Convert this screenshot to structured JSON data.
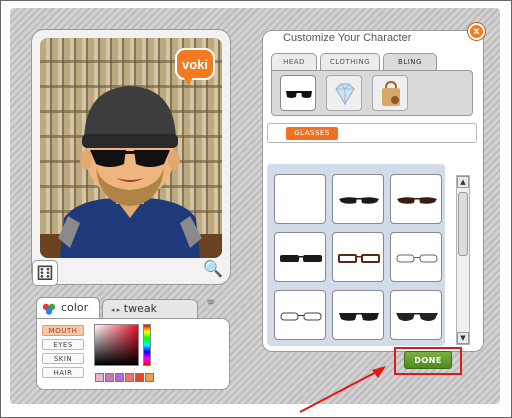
{
  "panel": {
    "title": "Customize Your Character",
    "close_label": "x"
  },
  "logo": {
    "text": "voki"
  },
  "category_tabs": [
    {
      "label": "HEAD",
      "active": false
    },
    {
      "label": "CLOTHING",
      "active": false
    },
    {
      "label": "BLING",
      "active": true
    }
  ],
  "item_types": [
    {
      "icon": "sunglasses-icon",
      "active": true
    },
    {
      "icon": "diamond-icon",
      "active": false
    },
    {
      "icon": "bag-icon",
      "active": false
    }
  ],
  "subcategory": {
    "label": "GLASSES"
  },
  "glasses_grid": [
    {
      "style": "none"
    },
    {
      "style": "dark-cat-eye"
    },
    {
      "style": "dark-cat-eye-brown"
    },
    {
      "style": "dark-wide"
    },
    {
      "style": "brown-rect-frame"
    },
    {
      "style": "thin-white-frame"
    },
    {
      "style": "thin-outline"
    },
    {
      "style": "dark-shield"
    },
    {
      "style": "dark-aviator"
    }
  ],
  "color_panel": {
    "color_tab": "color",
    "tweak_tab": "tweak",
    "features": [
      {
        "label": "MOUTH",
        "active": true
      },
      {
        "label": "EYES",
        "active": false
      },
      {
        "label": "SKIN",
        "active": false
      },
      {
        "label": "HAIR",
        "active": false
      }
    ],
    "swatches": [
      "#e8b5c8",
      "#c77ab7",
      "#b56ad8",
      "#f07070",
      "#e04a2a",
      "#f39a55"
    ]
  },
  "done": {
    "label": "DONE"
  },
  "colors": {
    "accent_orange": "#f27022",
    "done_green": "#5a9628",
    "highlight_red": "#e01818"
  }
}
